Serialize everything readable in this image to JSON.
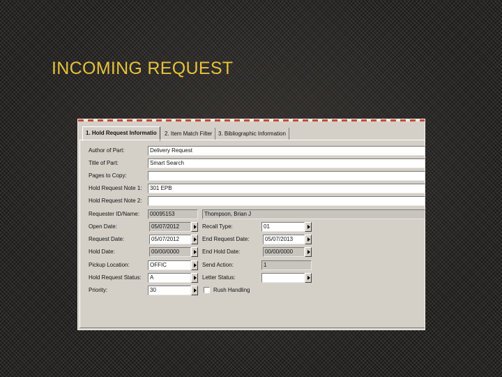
{
  "slide": {
    "title": "INCOMING REQUEST"
  },
  "tabs": [
    {
      "label": "1. Hold Request Informatio"
    },
    {
      "label": "2. Item Match Filter"
    },
    {
      "label": "3. Bibliographic Information"
    }
  ],
  "form": {
    "author_of_part": {
      "label": "Author of Part:",
      "value": "Delivery Request"
    },
    "title_of_part": {
      "label": "Title of Part:",
      "value": "Smart Search"
    },
    "pages_to_copy": {
      "label": "Pages to Copy:",
      "value": ""
    },
    "hold_request_note_1": {
      "label": "Hold Request Note 1:",
      "value": "301 EPB"
    },
    "hold_request_note_2": {
      "label": "Hold Request Note 2:",
      "value": ""
    },
    "requester": {
      "label": "Requester ID/Name:",
      "id": "00095153",
      "name": "Thompson, Brian J"
    },
    "open_date": {
      "label": "Open Date:",
      "value": "05/07/2012"
    },
    "request_date": {
      "label": "Request Date:",
      "value": "05/07/2012"
    },
    "hold_date": {
      "label": "Hold Date:",
      "value": "00/00/0000"
    },
    "pickup_location": {
      "label": "Pickup Location:",
      "value": "OFFIC"
    },
    "hold_request_status": {
      "label": "Hold Request Status:",
      "value": "A"
    },
    "priority": {
      "label": "Priority:",
      "value": "30"
    },
    "recall_type": {
      "label": "Recall Type:",
      "value": "01"
    },
    "end_request_date": {
      "label": "End Request Date:",
      "value": "05/07/2013"
    },
    "end_hold_date": {
      "label": "End Hold Date:",
      "value": "00/00/0000"
    },
    "send_action": {
      "label": "Send Action:",
      "value": "1"
    },
    "letter_status": {
      "label": "Letter Status:",
      "value": ""
    },
    "rush_handling": {
      "label": "Rush Handling",
      "checked": false
    }
  }
}
